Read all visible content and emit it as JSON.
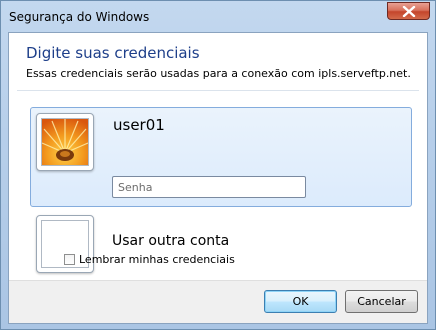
{
  "window": {
    "title": "Segurança do Windows",
    "close_icon": "close-icon"
  },
  "header": {
    "title": "Digite suas credenciais",
    "subtitle": "Essas credenciais serão usadas para a conexão com ipls.serveftp.net."
  },
  "credentials": {
    "user_tile": {
      "username": "user01",
      "avatar_icon": "orange-flower-avatar-icon",
      "password_placeholder": "Senha",
      "password_value": ""
    },
    "other_tile": {
      "label": "Usar outra conta",
      "avatar_icon": "blank-avatar-icon"
    },
    "remember": {
      "label": "Lembrar minhas credenciais",
      "checked": false
    }
  },
  "footer": {
    "ok_label": "OK",
    "cancel_label": "Cancelar"
  },
  "colors": {
    "heading": "#1e3f8a",
    "selected_tile_border": "#84acdd",
    "close_button": "#c4452c"
  }
}
